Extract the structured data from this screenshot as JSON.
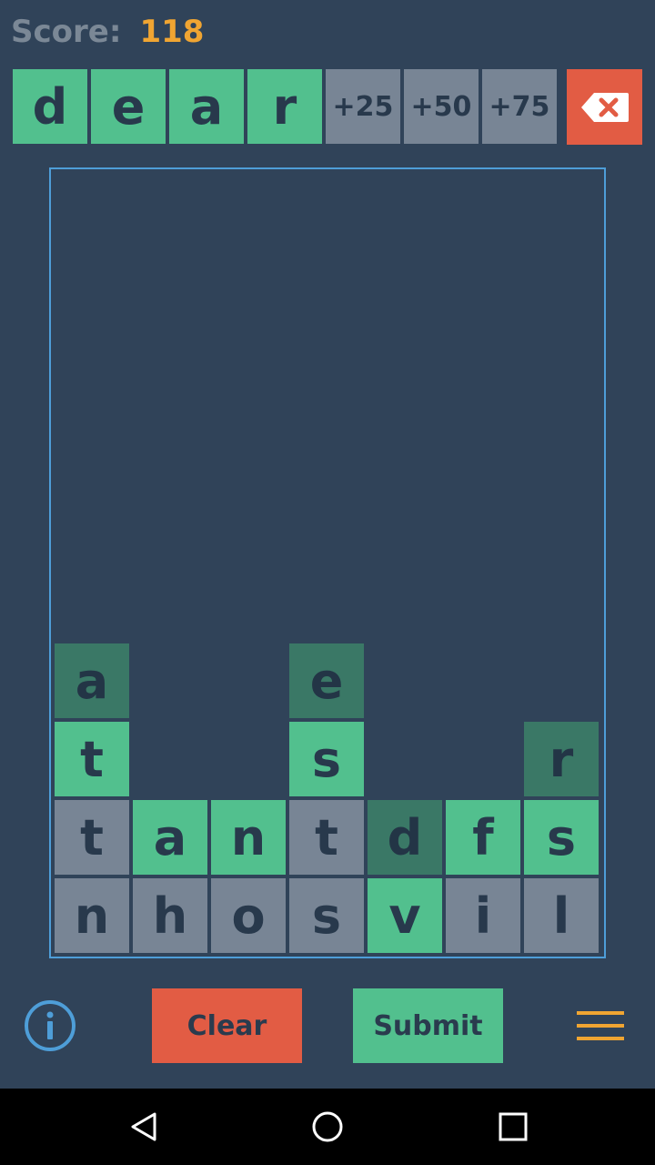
{
  "header": {
    "score_label": "Score:",
    "score_value": "118"
  },
  "current_word": {
    "letters": [
      "d",
      "e",
      "a",
      "r"
    ],
    "bonuses": [
      "+25",
      "+50",
      "+75"
    ]
  },
  "board": {
    "rows": [
      [
        "a",
        "",
        "",
        "e",
        "",
        "",
        ""
      ],
      [
        "t",
        "",
        "",
        "s",
        "",
        "",
        "r"
      ],
      [
        "t",
        "a",
        "n",
        "t",
        "d",
        "f",
        "s"
      ],
      [
        "n",
        "h",
        "o",
        "s",
        "v",
        "i",
        "l"
      ]
    ],
    "states": [
      [
        "dark",
        "",
        "",
        "dark",
        "",
        "",
        ""
      ],
      [
        "green",
        "",
        "",
        "green",
        "",
        "",
        "dark"
      ],
      [
        "grey",
        "green",
        "green",
        "grey",
        "dark",
        "green",
        "green"
      ],
      [
        "grey",
        "grey",
        "grey",
        "grey",
        "green",
        "grey",
        "grey"
      ]
    ]
  },
  "controls": {
    "clear_label": "Clear",
    "submit_label": "Submit"
  },
  "colors": {
    "background": "#304359",
    "tile_green": "#52c08e",
    "tile_grey": "#788595",
    "tile_dark": "#3a7866",
    "accent_red": "#e25c44",
    "score_orange": "#f0a532",
    "board_border": "#4e9ed8"
  }
}
